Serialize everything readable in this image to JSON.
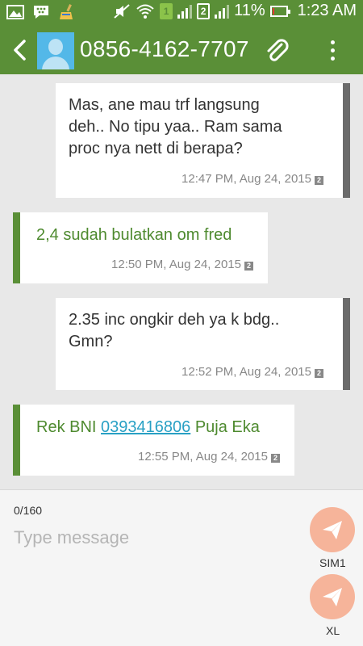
{
  "status_bar": {
    "battery_percent_label": "11%",
    "time": "1:23 AM",
    "sim1_label": "1",
    "sim2_label": "2",
    "battery_level": 0.11,
    "left_icons": [
      "gallery-icon",
      "bbm-icon",
      "cleaner-icon"
    ],
    "right_icons": [
      "mute-icon",
      "wifi-icon",
      "sim1-icon",
      "signal-icon",
      "sim2-icon",
      "signal-icon",
      "battery-icon"
    ]
  },
  "header": {
    "contact_number": "0856-4162-7707",
    "icons": [
      "back-arrow-icon",
      "contact-avatar-icon",
      "paperclip-icon",
      "overflow-menu-icon"
    ]
  },
  "messages": [
    {
      "direction": "outgoing",
      "lines": [
        "Mas, ane mau trf langsung",
        "deh.. No tipu yaa.. Ram sama",
        "proc nya nett di berapa?"
      ],
      "timestamp": "12:47 PM, Aug 24, 2015",
      "sim_indicator": "2"
    },
    {
      "direction": "incoming",
      "lines": [
        "2,4 sudah bulatkan om fred"
      ],
      "timestamp": "12:50 PM, Aug 24, 2015",
      "sim_indicator": "2"
    },
    {
      "direction": "outgoing",
      "lines": [
        "2.35 inc ongkir deh ya k bdg..",
        "Gmn?"
      ],
      "timestamp": "12:52 PM, Aug 24, 2015",
      "sim_indicator": "2"
    },
    {
      "direction": "incoming",
      "text_before_link": "Rek BNI ",
      "link": "0393416806",
      "text_after_link": " Puja Eka",
      "timestamp": "12:55 PM, Aug 24, 2015",
      "sim_indicator": "2"
    }
  ],
  "composer": {
    "char_counter": "0/160",
    "placeholder": "Type message",
    "send_sim1_label": "SIM1",
    "send_sim2_label": "XL",
    "accent_color": "#f6b49a"
  },
  "colors": {
    "primary": "#5a8f37",
    "incoming_text": "#4e8a2f",
    "link": "#28a0c4"
  }
}
